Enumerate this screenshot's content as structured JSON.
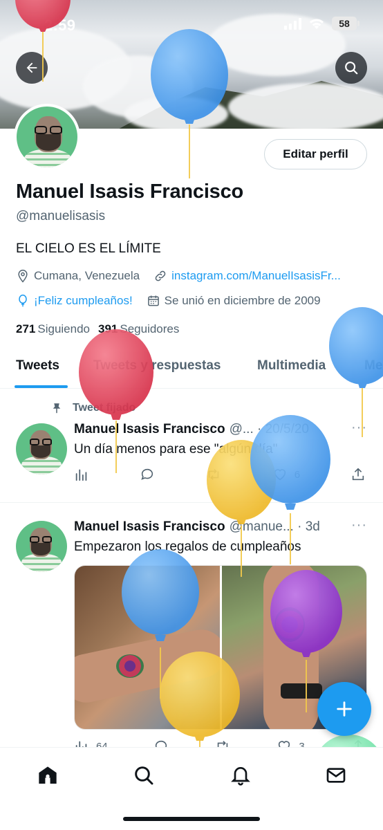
{
  "status_bar": {
    "time": "2:59",
    "battery": "58"
  },
  "profile": {
    "name": "Manuel Isasis Francisco",
    "handle": "@manuelisasis",
    "bio": "EL CIELO ES EL LÍMITE",
    "location": "Cumana, Venezuela",
    "link": "instagram.com/ManuelIsasisFr...",
    "birthday": "¡Feliz cumpleaños!",
    "joined": "Se unió en diciembre de 2009",
    "following_count": "271",
    "following_label": "Siguiendo",
    "followers_count": "391",
    "followers_label": "Seguidores",
    "edit_button": "Editar perfil"
  },
  "tabs": [
    {
      "label": "Tweets",
      "active": true
    },
    {
      "label": "Tweets y respuestas",
      "active": false
    },
    {
      "label": "Multimedia",
      "active": false
    },
    {
      "label": "Me",
      "active": false
    }
  ],
  "tweets": [
    {
      "pinned_label": "Tweet fijado",
      "name": "Manuel Isasis Francisco",
      "meta": "@... · 20/5/20",
      "text": "Un día menos para ese \"algún día\"",
      "likes": "6"
    },
    {
      "name": "Manuel Isasis Francisco",
      "meta": "@manue... · 3d",
      "text": "Empezaron los regalos de cumpleaños",
      "views": "64",
      "likes": "3"
    }
  ],
  "colors": {
    "accent": "#1d9bf0",
    "balloon_red": "#e8495f",
    "balloon_blue": "#4aa3f2",
    "balloon_yellow": "#f5c842",
    "balloon_purple": "#9b3fd6",
    "balloon_green": "#7be8b0"
  },
  "icons": {
    "back": "arrow-left-icon",
    "search": "search-icon",
    "location": "location-pin-icon",
    "link": "link-icon",
    "birthday": "balloon-icon",
    "calendar": "calendar-icon",
    "pin": "pin-icon",
    "views": "bar-chart-icon",
    "reply": "chat-bubble-icon",
    "retweet": "retweet-icon",
    "like": "heart-icon",
    "share": "share-icon",
    "compose": "plus-icon",
    "home": "home-icon",
    "explore": "search-icon",
    "notifications": "bell-icon",
    "messages": "mail-icon"
  }
}
